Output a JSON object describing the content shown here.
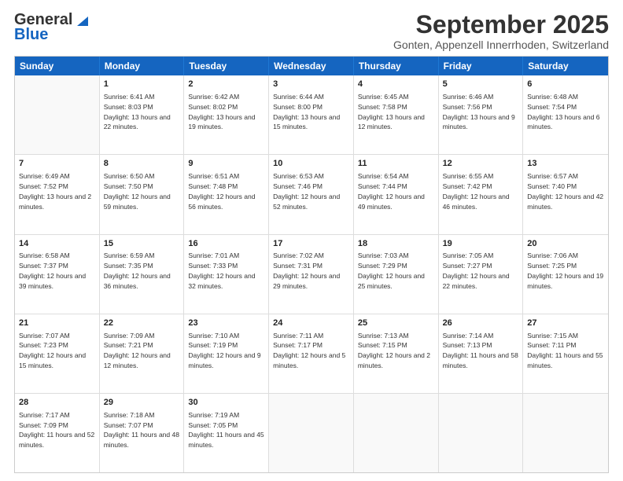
{
  "logo": {
    "line1": "General",
    "line2": "Blue"
  },
  "title": "September 2025",
  "subtitle": "Gonten, Appenzell Innerrhoden, Switzerland",
  "headers": [
    "Sunday",
    "Monday",
    "Tuesday",
    "Wednesday",
    "Thursday",
    "Friday",
    "Saturday"
  ],
  "rows": [
    [
      {
        "day": "",
        "sunrise": "",
        "sunset": "",
        "daylight": ""
      },
      {
        "day": "1",
        "sunrise": "Sunrise: 6:41 AM",
        "sunset": "Sunset: 8:03 PM",
        "daylight": "Daylight: 13 hours and 22 minutes."
      },
      {
        "day": "2",
        "sunrise": "Sunrise: 6:42 AM",
        "sunset": "Sunset: 8:02 PM",
        "daylight": "Daylight: 13 hours and 19 minutes."
      },
      {
        "day": "3",
        "sunrise": "Sunrise: 6:44 AM",
        "sunset": "Sunset: 8:00 PM",
        "daylight": "Daylight: 13 hours and 15 minutes."
      },
      {
        "day": "4",
        "sunrise": "Sunrise: 6:45 AM",
        "sunset": "Sunset: 7:58 PM",
        "daylight": "Daylight: 13 hours and 12 minutes."
      },
      {
        "day": "5",
        "sunrise": "Sunrise: 6:46 AM",
        "sunset": "Sunset: 7:56 PM",
        "daylight": "Daylight: 13 hours and 9 minutes."
      },
      {
        "day": "6",
        "sunrise": "Sunrise: 6:48 AM",
        "sunset": "Sunset: 7:54 PM",
        "daylight": "Daylight: 13 hours and 6 minutes."
      }
    ],
    [
      {
        "day": "7",
        "sunrise": "Sunrise: 6:49 AM",
        "sunset": "Sunset: 7:52 PM",
        "daylight": "Daylight: 13 hours and 2 minutes."
      },
      {
        "day": "8",
        "sunrise": "Sunrise: 6:50 AM",
        "sunset": "Sunset: 7:50 PM",
        "daylight": "Daylight: 12 hours and 59 minutes."
      },
      {
        "day": "9",
        "sunrise": "Sunrise: 6:51 AM",
        "sunset": "Sunset: 7:48 PM",
        "daylight": "Daylight: 12 hours and 56 minutes."
      },
      {
        "day": "10",
        "sunrise": "Sunrise: 6:53 AM",
        "sunset": "Sunset: 7:46 PM",
        "daylight": "Daylight: 12 hours and 52 minutes."
      },
      {
        "day": "11",
        "sunrise": "Sunrise: 6:54 AM",
        "sunset": "Sunset: 7:44 PM",
        "daylight": "Daylight: 12 hours and 49 minutes."
      },
      {
        "day": "12",
        "sunrise": "Sunrise: 6:55 AM",
        "sunset": "Sunset: 7:42 PM",
        "daylight": "Daylight: 12 hours and 46 minutes."
      },
      {
        "day": "13",
        "sunrise": "Sunrise: 6:57 AM",
        "sunset": "Sunset: 7:40 PM",
        "daylight": "Daylight: 12 hours and 42 minutes."
      }
    ],
    [
      {
        "day": "14",
        "sunrise": "Sunrise: 6:58 AM",
        "sunset": "Sunset: 7:37 PM",
        "daylight": "Daylight: 12 hours and 39 minutes."
      },
      {
        "day": "15",
        "sunrise": "Sunrise: 6:59 AM",
        "sunset": "Sunset: 7:35 PM",
        "daylight": "Daylight: 12 hours and 36 minutes."
      },
      {
        "day": "16",
        "sunrise": "Sunrise: 7:01 AM",
        "sunset": "Sunset: 7:33 PM",
        "daylight": "Daylight: 12 hours and 32 minutes."
      },
      {
        "day": "17",
        "sunrise": "Sunrise: 7:02 AM",
        "sunset": "Sunset: 7:31 PM",
        "daylight": "Daylight: 12 hours and 29 minutes."
      },
      {
        "day": "18",
        "sunrise": "Sunrise: 7:03 AM",
        "sunset": "Sunset: 7:29 PM",
        "daylight": "Daylight: 12 hours and 25 minutes."
      },
      {
        "day": "19",
        "sunrise": "Sunrise: 7:05 AM",
        "sunset": "Sunset: 7:27 PM",
        "daylight": "Daylight: 12 hours and 22 minutes."
      },
      {
        "day": "20",
        "sunrise": "Sunrise: 7:06 AM",
        "sunset": "Sunset: 7:25 PM",
        "daylight": "Daylight: 12 hours and 19 minutes."
      }
    ],
    [
      {
        "day": "21",
        "sunrise": "Sunrise: 7:07 AM",
        "sunset": "Sunset: 7:23 PM",
        "daylight": "Daylight: 12 hours and 15 minutes."
      },
      {
        "day": "22",
        "sunrise": "Sunrise: 7:09 AM",
        "sunset": "Sunset: 7:21 PM",
        "daylight": "Daylight: 12 hours and 12 minutes."
      },
      {
        "day": "23",
        "sunrise": "Sunrise: 7:10 AM",
        "sunset": "Sunset: 7:19 PM",
        "daylight": "Daylight: 12 hours and 9 minutes."
      },
      {
        "day": "24",
        "sunrise": "Sunrise: 7:11 AM",
        "sunset": "Sunset: 7:17 PM",
        "daylight": "Daylight: 12 hours and 5 minutes."
      },
      {
        "day": "25",
        "sunrise": "Sunrise: 7:13 AM",
        "sunset": "Sunset: 7:15 PM",
        "daylight": "Daylight: 12 hours and 2 minutes."
      },
      {
        "day": "26",
        "sunrise": "Sunrise: 7:14 AM",
        "sunset": "Sunset: 7:13 PM",
        "daylight": "Daylight: 11 hours and 58 minutes."
      },
      {
        "day": "27",
        "sunrise": "Sunrise: 7:15 AM",
        "sunset": "Sunset: 7:11 PM",
        "daylight": "Daylight: 11 hours and 55 minutes."
      }
    ],
    [
      {
        "day": "28",
        "sunrise": "Sunrise: 7:17 AM",
        "sunset": "Sunset: 7:09 PM",
        "daylight": "Daylight: 11 hours and 52 minutes."
      },
      {
        "day": "29",
        "sunrise": "Sunrise: 7:18 AM",
        "sunset": "Sunset: 7:07 PM",
        "daylight": "Daylight: 11 hours and 48 minutes."
      },
      {
        "day": "30",
        "sunrise": "Sunrise: 7:19 AM",
        "sunset": "Sunset: 7:05 PM",
        "daylight": "Daylight: 11 hours and 45 minutes."
      },
      {
        "day": "",
        "sunrise": "",
        "sunset": "",
        "daylight": ""
      },
      {
        "day": "",
        "sunrise": "",
        "sunset": "",
        "daylight": ""
      },
      {
        "day": "",
        "sunrise": "",
        "sunset": "",
        "daylight": ""
      },
      {
        "day": "",
        "sunrise": "",
        "sunset": "",
        "daylight": ""
      }
    ]
  ]
}
